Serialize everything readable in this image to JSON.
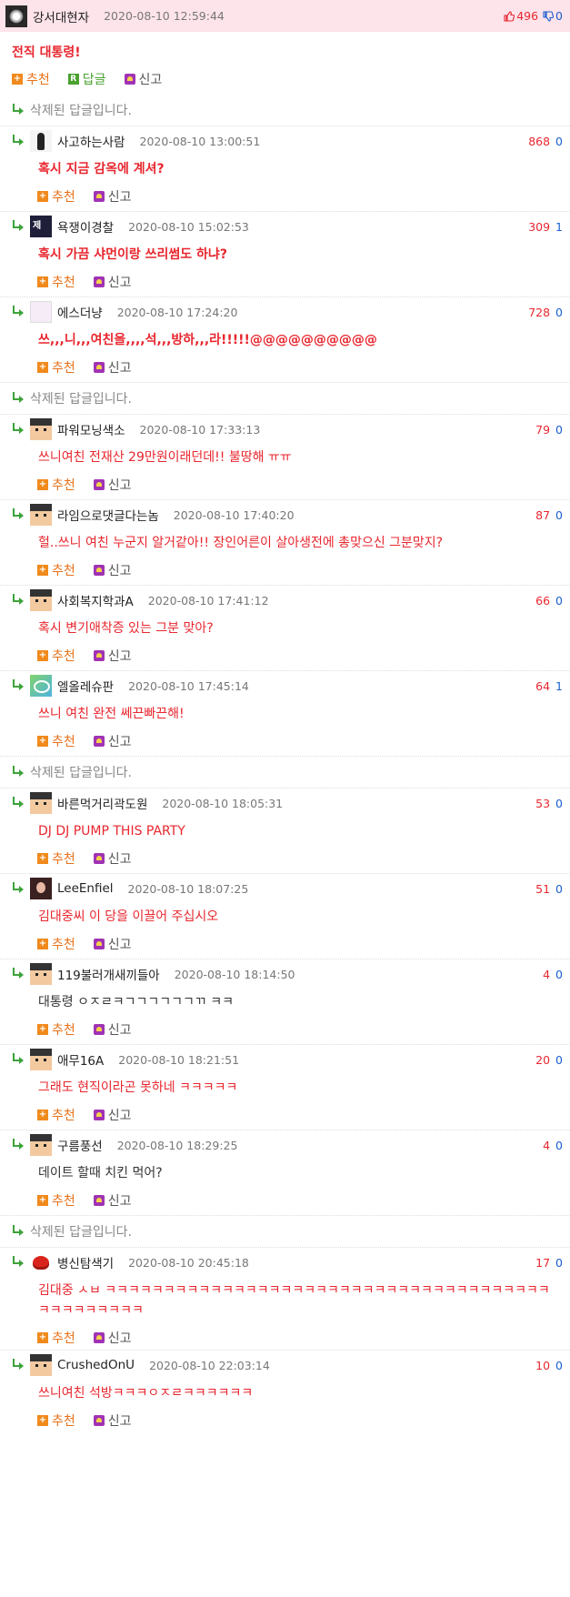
{
  "root": {
    "nickname": "강서대현자",
    "date": "2020-08-10 12:59:44",
    "up": "496",
    "down": "0",
    "body": "전직 대통령!",
    "actions": {
      "recommend": "추천",
      "reply": "답글",
      "report": "신고"
    }
  },
  "deleted_text": "삭제된 답글입니다.",
  "action_labels": {
    "recommend": "추천",
    "report": "신고"
  },
  "replies": [
    {
      "nickname": "사고하는사람",
      "date": "2020-08-10 13:00:51",
      "up": "868",
      "down": "0",
      "body": "혹시 지금 감옥에 계셔?"
    },
    {
      "nickname": "욕쟁이경찰",
      "date": "2020-08-10 15:02:53",
      "up": "309",
      "down": "1",
      "body": "혹시 가끔 샤먼이랑 쓰리썸도 하냐?"
    },
    {
      "nickname": "에스더냥",
      "date": "2020-08-10 17:24:20",
      "up": "728",
      "down": "0",
      "body": "쓰,,,니,,,여친을,,,,석,,,방하,,,라!!!!!@@@@@@@@@@"
    },
    {
      "nickname": "파워모닝색소",
      "date": "2020-08-10 17:33:13",
      "up": "79",
      "down": "0",
      "body": "쓰니여친 전재산 29만원이래던데!! 불땅해 ㅠㅠ"
    },
    {
      "nickname": "라임으로댓글다는놈",
      "date": "2020-08-10 17:40:20",
      "up": "87",
      "down": "0",
      "body": "헐..쓰니 여친 누군지 알거같아!! 장인어른이 살아생전에 총맞으신 그분맞지?"
    },
    {
      "nickname": "사회복지학과A",
      "date": "2020-08-10 17:41:12",
      "up": "66",
      "down": "0",
      "body": "혹시 변기애착증 있는 그분 맞아?"
    },
    {
      "nickname": "엘올레슈판",
      "date": "2020-08-10 17:45:14",
      "up": "64",
      "down": "1",
      "body": "쓰니 여친 완전 쎄끈빠끈해!"
    },
    {
      "nickname": "바른먹거리곽도원",
      "date": "2020-08-10 18:05:31",
      "up": "53",
      "down": "0",
      "body": "DJ DJ PUMP THIS PARTY"
    },
    {
      "nickname": "LeeEnfiel",
      "date": "2020-08-10 18:07:25",
      "up": "51",
      "down": "0",
      "body": "김대중씨 이 당을 이끌어 주십시오"
    },
    {
      "nickname": "119불러개새끼들아",
      "date": "2020-08-10 18:14:50",
      "up": "4",
      "down": "0",
      "body": "대통령 ㅇㅈㄹㅋㄱㄱㄱㄱㄱㄱㄲ ㅋㅋ"
    },
    {
      "nickname": "애무16A",
      "date": "2020-08-10 18:21:51",
      "up": "20",
      "down": "0",
      "body": "그래도 현직이라곤 못하네 ㅋㅋㅋㅋㅋ"
    },
    {
      "nickname": "구름풍선",
      "date": "2020-08-10 18:29:25",
      "up": "4",
      "down": "0",
      "body": "데이트 할때 치킨 먹어?"
    },
    {
      "nickname": "병신탐색기",
      "date": "2020-08-10 20:45:18",
      "up": "17",
      "down": "0",
      "body": "김대중 ㅅㅂ ㅋㅋㅋㅋㅋㅋㅋㅋㅋㅋㅋㅋㅋㅋㅋㅋㅋㅋㅋㅋㅋㅋㅋㅋㅋㅋㅋㅋㅋㅋㅋㅋㅋㅋㅋㅋㅋㅋㅋㅋㅋㅋㅋㅋㅋㅋㅋ"
    },
    {
      "nickname": "CrushedOnU",
      "date": "2020-08-10 22:03:14",
      "up": "10",
      "down": "0",
      "body": "쓰니여친 석방ㅋㅋㅋㅇㅈㄹㅋㅋㅋㅋㅋㅋ"
    }
  ]
}
